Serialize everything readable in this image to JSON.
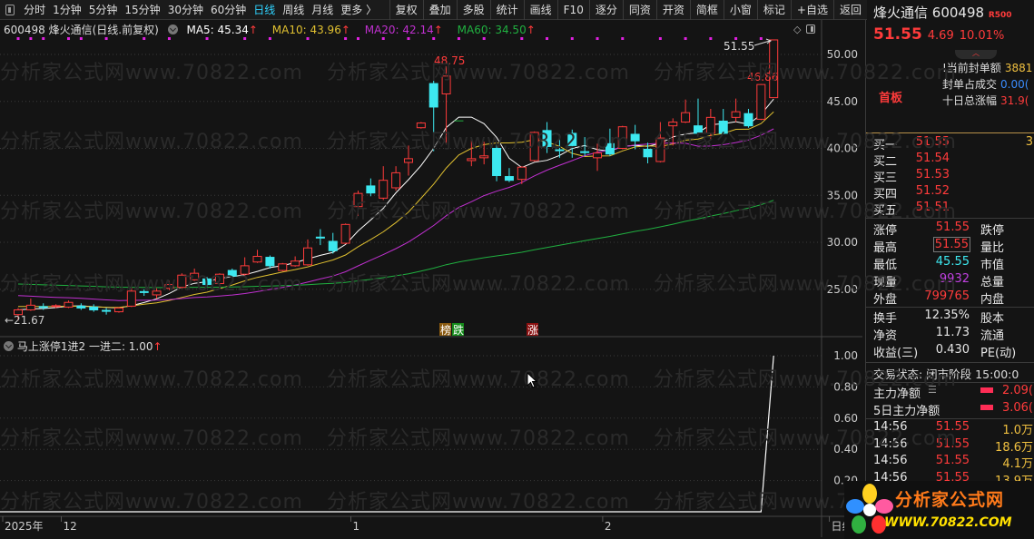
{
  "toolbar": {
    "periods": [
      "分时",
      "1分钟",
      "5分钟",
      "15分钟",
      "30分钟",
      "60分钟",
      "日线",
      "周线",
      "月线",
      "更多 〉"
    ],
    "active_period": "日线",
    "buttons": [
      "复权",
      "叠加",
      "多股",
      "统计",
      "画线",
      "F10",
      "逐分",
      "同资",
      "开资",
      "简框",
      "小窗",
      "标记",
      "+自选",
      "返回"
    ]
  },
  "info": {
    "title": "600498 烽火通信(日线.前复权)",
    "ma5": "MA5: 45.34",
    "ma10": "MA10: 43.96",
    "ma20": "MA20: 42.14",
    "ma60": "MA60: 34.50",
    "arrow": "↑"
  },
  "indicator": {
    "title": "马上涨停1进2",
    "value": "一进二: 1.00",
    "arrow": "↑"
  },
  "watermark": "分析家公式网www.70822.com",
  "markers": {
    "bang": "榜",
    "die": "跌",
    "zhang": "涨"
  },
  "annotations": {
    "high": "48.75",
    "last": "51.55",
    "mid": "46.86",
    "low": "←21.67"
  },
  "colors": {
    "up": "#ff3b3b",
    "down": "#3de8f0",
    "ma5": "#ffffff",
    "ma10": "#e0c030",
    "ma20": "#c030d0",
    "ma60": "#20b040",
    "signal": "#e020e0"
  },
  "chart_data": [
    {
      "type": "candlestick",
      "title": "600498 烽火通信(日线.前复权)",
      "yticks": [
        "50.00",
        "45.00",
        "40.00",
        "35.00",
        "30.00",
        "25.00"
      ],
      "ytick_values": [
        50,
        45,
        40,
        35,
        30,
        25
      ],
      "ylim": [
        20.7,
        52.2
      ],
      "xlabels": [
        {
          "i": -1,
          "label": "2025年"
        },
        {
          "i": 4,
          "label": "12"
        },
        {
          "i": 27,
          "label": "1"
        },
        {
          "i": 47,
          "label": "2"
        },
        {
          "i": 65,
          "label": "日线"
        }
      ],
      "ohlc": [
        [
          22.3,
          23.0,
          21.67,
          22.8
        ],
        [
          22.8,
          24.0,
          22.7,
          23.3
        ],
        [
          23.15,
          23.5,
          22.8,
          23.05
        ],
        [
          23.2,
          23.4,
          23.0,
          23.25
        ],
        [
          23.1,
          23.8,
          23.0,
          23.6
        ],
        [
          23.2,
          23.5,
          22.8,
          23.0
        ],
        [
          23.1,
          23.4,
          22.6,
          22.8
        ],
        [
          22.75,
          23.0,
          22.3,
          22.65
        ],
        [
          22.6,
          23.1,
          22.5,
          23.0
        ],
        [
          23.2,
          25.2,
          23.1,
          24.8
        ],
        [
          24.75,
          25.0,
          24.3,
          24.65
        ],
        [
          24.4,
          25.1,
          24.0,
          24.8
        ],
        [
          25.1,
          25.9,
          24.9,
          25.5
        ],
        [
          25.2,
          26.7,
          25.1,
          26.5
        ],
        [
          26.0,
          27.2,
          25.9,
          26.7
        ],
        [
          26.1,
          26.3,
          25.3,
          25.5
        ],
        [
          25.6,
          26.7,
          25.5,
          26.6
        ],
        [
          27.0,
          27.2,
          26.2,
          26.4
        ],
        [
          26.6,
          28.4,
          26.4,
          27.5
        ],
        [
          27.9,
          29.2,
          27.8,
          28.5
        ],
        [
          28.4,
          28.6,
          27.2,
          27.5
        ],
        [
          27.0,
          27.8,
          26.9,
          27.7
        ],
        [
          27.5,
          28.5,
          27.4,
          28.0
        ],
        [
          27.6,
          30.3,
          27.5,
          29.4
        ],
        [
          30.55,
          31.4,
          29.7,
          30.45
        ],
        [
          30.1,
          31.0,
          28.8,
          29.1
        ],
        [
          29.9,
          32.0,
          29.8,
          31.9
        ],
        [
          33.8,
          35.5,
          32.8,
          35.2
        ],
        [
          36.0,
          36.8,
          34.9,
          35.25
        ],
        [
          34.7,
          38.1,
          34.5,
          36.6
        ],
        [
          35.8,
          38.1,
          35.5,
          37.4
        ],
        [
          38.5,
          40.3,
          37.1,
          38.9
        ],
        [
          42.2,
          42.8,
          42.1,
          42.7
        ],
        [
          46.9,
          47.2,
          39.7,
          44.4
        ],
        [
          45.8,
          48.75,
          40.4,
          47.7
        ],
        [
          42.93,
          42.93,
          42.93,
          42.93
        ],
        [
          38.7,
          40.9,
          38.1,
          38.9
        ],
        [
          39.0,
          40.7,
          38.3,
          39.2
        ],
        [
          40.0,
          40.4,
          36.5,
          37.1
        ],
        [
          37.0,
          37.9,
          36.4,
          36.6
        ],
        [
          36.7,
          38.1,
          36.2,
          38.0
        ],
        [
          38.7,
          41.8,
          38.6,
          41.7
        ],
        [
          41.9,
          42.8,
          39.5,
          40.2
        ],
        [
          39.85,
          41.5,
          39.0,
          39.75
        ],
        [
          41.6,
          42.0,
          39.0,
          40.3
        ],
        [
          39.65,
          41.2,
          39.2,
          39.55
        ],
        [
          39.0,
          40.5,
          37.6,
          39.5
        ],
        [
          40.5,
          42.1,
          39.2,
          39.4
        ],
        [
          40.0,
          42.4,
          39.9,
          42.3
        ],
        [
          41.5,
          42.5,
          39.9,
          40.8
        ],
        [
          39.9,
          40.6,
          38.4,
          39.1
        ],
        [
          38.6,
          42.8,
          38.5,
          41.1
        ],
        [
          42.4,
          43.2,
          40.3,
          42.8
        ],
        [
          42.8,
          45.2,
          42.7,
          43.8
        ],
        [
          42.4,
          45.3,
          41.4,
          41.6
        ],
        [
          41.6,
          44.2,
          40.9,
          43.3
        ],
        [
          42.9,
          44.2,
          41.5,
          41.6
        ],
        [
          43.3,
          45.3,
          42.8,
          43.9
        ],
        [
          43.7,
          44.2,
          42.2,
          42.4
        ],
        [
          43.1,
          46.86,
          43.0,
          46.8
        ],
        [
          45.4,
          51.55,
          45.4,
          51.55
        ]
      ],
      "ma_periods": [
        5,
        10,
        20,
        60
      ],
      "signal_dots": [
        0,
        1,
        2,
        4,
        5,
        7,
        10,
        12,
        15,
        18,
        20,
        23,
        26,
        27,
        29,
        31,
        33,
        35,
        37,
        40,
        42,
        44,
        46,
        48,
        51,
        53,
        55,
        57,
        59
      ]
    },
    {
      "type": "line",
      "title": "马上涨停1进2",
      "series": [
        {
          "name": "一进二",
          "values_note": "0 for all days except last",
          "last": 1.0
        }
      ],
      "yticks": [
        "1.00",
        "0.80",
        "0.60",
        "0.40",
        "0.20"
      ],
      "ytick_values": [
        1.0,
        0.8,
        0.6,
        0.4,
        0.2
      ],
      "ylim": [
        0,
        1.0
      ]
    }
  ],
  "quote": {
    "name": "烽火通信",
    "code": "600498",
    "badge": "R500",
    "price": "51.55",
    "change": "4.69",
    "pct": "10.01%",
    "tag": "首板",
    "seal_rows": [
      {
        "label": "!当前封单额",
        "value": "3881"
      },
      {
        "label": "封单占成交",
        "value": "0.00("
      },
      {
        "label": "十日总涨幅",
        "value": "31.9("
      }
    ],
    "bids": [
      {
        "label": "买一",
        "price": "51.55",
        "vol": "3"
      },
      {
        "label": "买二",
        "price": "51.54"
      },
      {
        "label": "买三",
        "price": "51.53"
      },
      {
        "label": "买四",
        "price": "51.52"
      },
      {
        "label": "买五",
        "price": "51.51"
      }
    ],
    "stats1": [
      {
        "l": "涨停",
        "v": "51.55",
        "r": "跌停"
      },
      {
        "l": "最高",
        "v": "51.55",
        "r": "量比"
      },
      {
        "l": "最低",
        "v": "45.55",
        "r": "市值"
      },
      {
        "l": "现量",
        "v": "9932",
        "r": "总量"
      },
      {
        "l": "外盘",
        "v": "799765",
        "r": "内盘"
      }
    ],
    "stats2": [
      {
        "l": "换手",
        "v": "12.35%",
        "r": "股本"
      },
      {
        "l": "净资",
        "v": "11.73",
        "r": "流通"
      },
      {
        "l": "收益(三)",
        "v": "0.430",
        "r": "PE(动)"
      }
    ],
    "status": "交易状态: 闭市阶段 15:00:0",
    "flows": [
      {
        "l": "主力净额",
        "v": "2.09("
      },
      {
        "l": "5日主力净额",
        "v": "3.06("
      }
    ],
    "ticks": [
      {
        "t": "14:56",
        "p": "51.55",
        "v": "1.0万"
      },
      {
        "t": "14:56",
        "p": "51.55",
        "v": "18.6万"
      },
      {
        "t": "14:56",
        "p": "51.55",
        "v": "4.1万"
      },
      {
        "t": "14:56",
        "p": "51.55",
        "v": "13.9万"
      }
    ]
  },
  "logo": {
    "name": "分析家公式网",
    "url": "WWW.70822.COM"
  }
}
